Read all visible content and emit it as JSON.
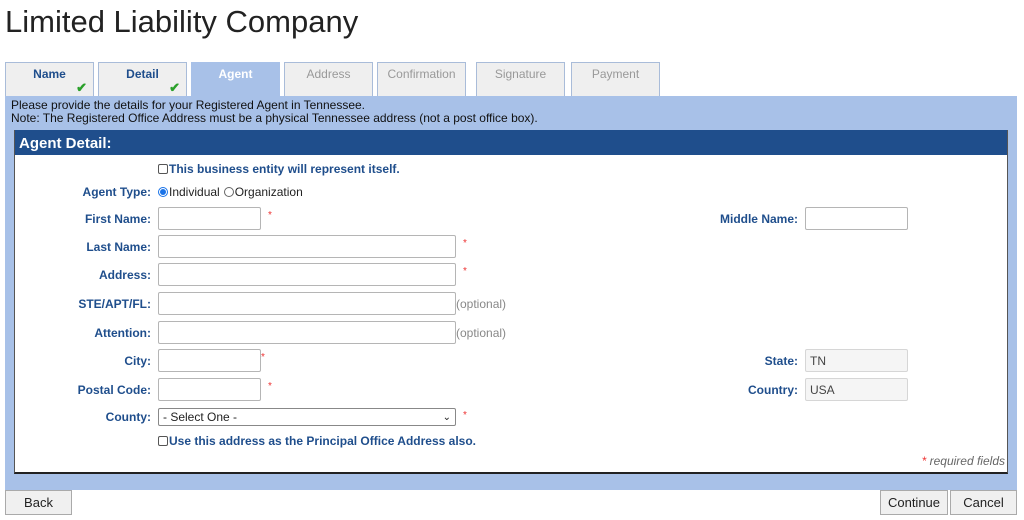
{
  "page": {
    "title": "Limited Liability Company"
  },
  "tabs": [
    {
      "label": "Name",
      "state": "done",
      "check_icon": "checkmark-icon"
    },
    {
      "label": "Detail",
      "state": "done",
      "check_icon": "checkmark-icon"
    },
    {
      "label": "Agent",
      "state": "active"
    },
    {
      "label": "Address",
      "state": "pending"
    },
    {
      "label": "Confirmation",
      "state": "pending"
    },
    {
      "label": "Signature",
      "state": "pending"
    },
    {
      "label": "Payment",
      "state": "pending"
    }
  ],
  "intro": {
    "line1": "Please provide the details for your Registered Agent in Tennessee.",
    "line2": "Note: The Registered Office Address must be a physical Tennessee address (not a post office box)."
  },
  "section": {
    "title": "Agent Detail:"
  },
  "form": {
    "self_represent": {
      "label": "This business entity will represent itself.",
      "checked": false
    },
    "agent_type": {
      "label": "Agent Type:",
      "options": [
        "Individual",
        "Organization"
      ],
      "selected": "Individual"
    },
    "first_name": {
      "label": "First Name:",
      "value": "",
      "required": "*"
    },
    "middle_name": {
      "label": "Middle Name:",
      "value": ""
    },
    "last_name": {
      "label": "Last Name:",
      "value": "",
      "required": "*"
    },
    "address": {
      "label": "Address:",
      "value": "",
      "required": "*"
    },
    "ste_apt_fl": {
      "label": "STE/APT/FL:",
      "value": "",
      "hint": "(optional)"
    },
    "attention": {
      "label": "Attention:",
      "value": "",
      "hint": "(optional)"
    },
    "city": {
      "label": "City:",
      "value": "",
      "required": "*"
    },
    "state": {
      "label": "State:",
      "value": "TN"
    },
    "postal_code": {
      "label": "Postal Code:",
      "value": "",
      "required": "*"
    },
    "country": {
      "label": "Country:",
      "value": "USA"
    },
    "county": {
      "label": "County:",
      "selected": "- Select One -",
      "required": "*"
    },
    "use_as_principal": {
      "label": "Use this address as the Principal Office Address also.",
      "checked": false
    },
    "required_note": {
      "star": "*",
      "text": " required fields"
    }
  },
  "buttons": {
    "back": "Back",
    "continue": "Continue",
    "cancel": "Cancel"
  },
  "colors": {
    "accent": "#1f4e8c",
    "panel": "#a8c1e8",
    "required": "#e33333",
    "check": "#2aa02a"
  }
}
